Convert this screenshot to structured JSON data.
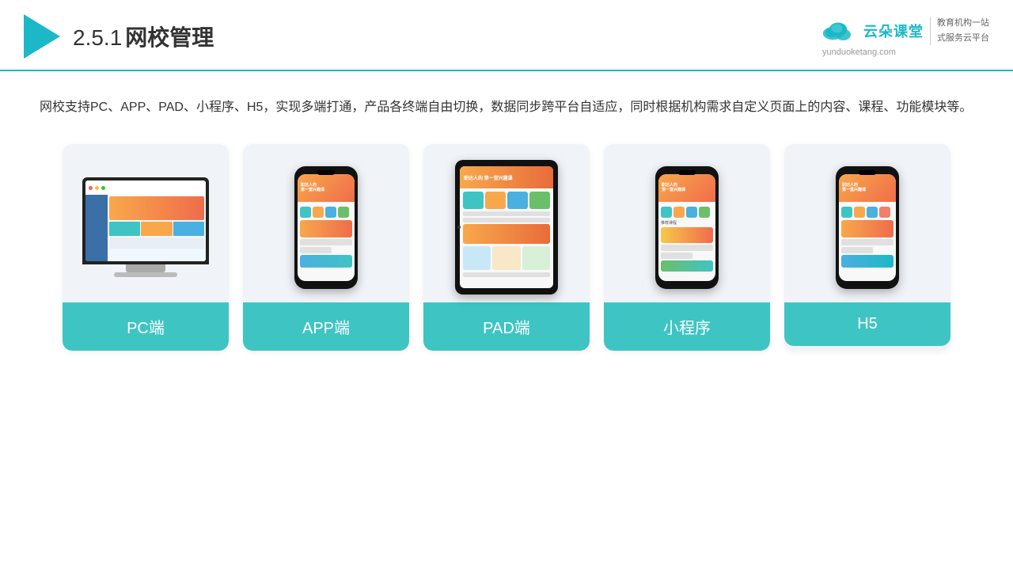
{
  "header": {
    "page_number": "2.5.1",
    "page_title": "网校管理",
    "brand_name": "云朵课堂",
    "brand_url": "yunduoketang.com",
    "brand_tagline_line1": "教育机构一站",
    "brand_tagline_line2": "式服务云平台"
  },
  "description": {
    "text": "网校支持PC、APP、PAD、小程序、H5，实现多端打通，产品各终端自由切换，数据同步跨平台自适应，同时根据机构需求自定义页面上的内容、课程、功能模块等。"
  },
  "cards": [
    {
      "id": "pc",
      "label": "PC端"
    },
    {
      "id": "app",
      "label": "APP端"
    },
    {
      "id": "pad",
      "label": "PAD端"
    },
    {
      "id": "miniprogram",
      "label": "小程序"
    },
    {
      "id": "h5",
      "label": "H5"
    }
  ]
}
